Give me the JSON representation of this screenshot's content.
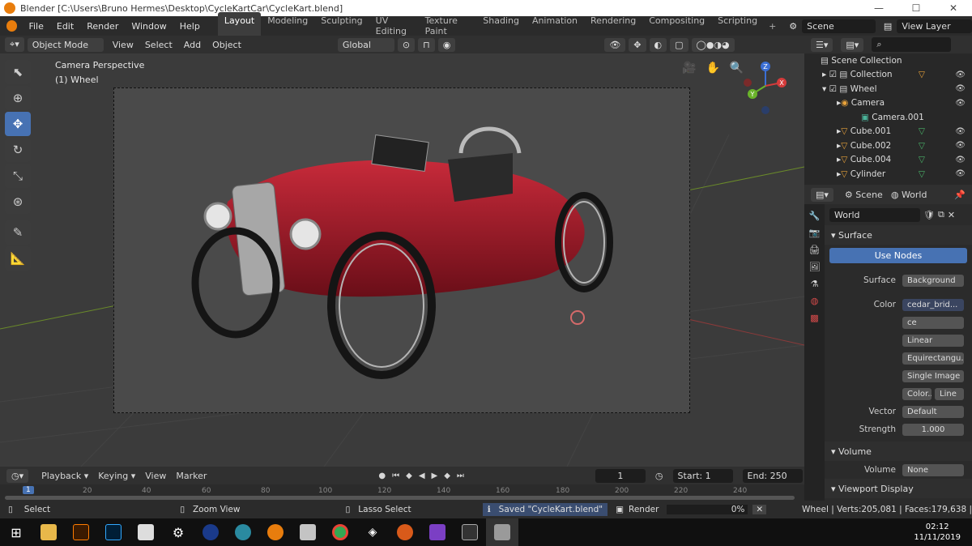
{
  "window": {
    "title": "Blender [C:\\Users\\Bruno Hermes\\Desktop\\CycleKartCar\\CycleKart.blend]",
    "minimize": "—",
    "maximize": "☐",
    "close": "✕"
  },
  "menu": [
    "File",
    "Edit",
    "Render",
    "Window",
    "Help"
  ],
  "workspaces": [
    "Layout",
    "Modeling",
    "Sculpting",
    "UV Editing",
    "Texture Paint",
    "Shading",
    "Animation",
    "Rendering",
    "Compositing",
    "Scripting"
  ],
  "scene_field": "Scene",
  "view_layer_field": "View Layer",
  "header": {
    "mode": "Object Mode",
    "view": "View",
    "select": "Select",
    "add": "Add",
    "object": "Object",
    "orientation": "Global"
  },
  "viewport": {
    "overlay_title": "Camera Perspective",
    "overlay_sub": "(1) Wheel"
  },
  "gizmo": {
    "x": "X",
    "y": "Y",
    "z": "Z"
  },
  "outliner": {
    "search_placeholder": "",
    "items": [
      {
        "label": "Scene Collection",
        "color": "#cccccc"
      },
      {
        "label": "Collection"
      },
      {
        "label": "Wheel"
      },
      {
        "label": "Camera"
      },
      {
        "label": "Camera.001"
      },
      {
        "label": "Cube.001"
      },
      {
        "label": "Cube.002"
      },
      {
        "label": "Cube.004"
      },
      {
        "label": "Cylinder"
      }
    ]
  },
  "properties": {
    "scene_tab": "Scene",
    "world_tab": "World",
    "world_name": "World",
    "surface_section": "Surface",
    "use_nodes": "Use Nodes",
    "rows": [
      {
        "label": "Surface",
        "value": "Background"
      },
      {
        "label": "Color",
        "value": "cedar_brid..."
      }
    ],
    "image_name": "ce",
    "image_options": [
      "Linear",
      "Equirectangu..",
      "Single Image"
    ],
    "color_opt": "Color..",
    "line_opt": "Line",
    "vector_label": "Vector",
    "vector_value": "Default",
    "strength_label": "Strength",
    "strength_value": "1.000",
    "volume_section": "Volume",
    "volume_label": "Volume",
    "volume_value": "None",
    "viewport_display": "Viewport Display"
  },
  "timeline": {
    "playback": "Playback",
    "keying": "Keying",
    "view": "View",
    "marker": "Marker",
    "current_frame": "1",
    "start_label": "Start:",
    "start": "1",
    "end_label": "End:",
    "end": "250",
    "ticks": [
      "1",
      "20",
      "40",
      "60",
      "80",
      "100",
      "120",
      "140",
      "160",
      "180",
      "200",
      "220",
      "240"
    ]
  },
  "status": {
    "select": "Select",
    "zoom": "Zoom View",
    "lasso": "Lasso Select",
    "saved": "Saved \"CycleKart.blend\"",
    "render": "Render",
    "progress": "0%",
    "stats": "Wheel | Verts:205,081 | Faces:179,638 | Tris:3"
  },
  "taskbar": {
    "time": "02:12",
    "date": "11/11/2019"
  }
}
